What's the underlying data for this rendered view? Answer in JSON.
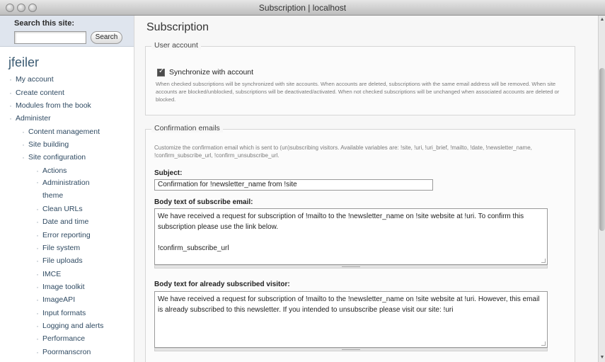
{
  "window": {
    "title": "Subscription | localhost"
  },
  "sidebar": {
    "search_label": "Search this site:",
    "search_placeholder": "",
    "search_button": "Search",
    "username": "jfeiler",
    "items": [
      "My account",
      "Create content",
      "Modules from the book",
      "Administer",
      "Content management",
      "Site building",
      "Site configuration",
      "Actions",
      "Administration theme",
      "Clean URLs",
      "Date and time",
      "Error reporting",
      "File system",
      "File uploads",
      "IMCE",
      "Image toolkit",
      "ImageAPI",
      "Input formats",
      "Logging and alerts",
      "Performance",
      "Poormanscron"
    ]
  },
  "main": {
    "page_title": "Subscription",
    "user_account": {
      "legend": "User account",
      "sync_label": "Synchronize with account",
      "sync_checked": true,
      "description": "When checked subscriptions will be synchronized with site accounts. When accounts are deleted, subscriptions with the same email address will be removed. When site accounts are blocked/unblocked, subscriptions will be deactivated/activated. When not checked subscriptions will be unchanged when associated accounts are deleted or blocked."
    },
    "confirmation": {
      "legend": "Confirmation emails",
      "description": "Customize the confirmation email which is sent to (un)subscribing visitors. Available variables are: !site, !uri, !uri_brief, !mailto, !date, !newsletter_name, !confirm_subscribe_url, !confirm_unsubscribe_url.",
      "subject_label": "Subject:",
      "subject_value": "Confirmation for !newsletter_name from !site",
      "body_subscribe_label": "Body text of subscribe email:",
      "body_subscribe_value": "We have received a request for subscription of !mailto to the !newsletter_name on !site website at !uri. To confirm this subscription please use the link below.\n\n!confirm_subscribe_url",
      "body_already_label": "Body text for already subscribed visitor:",
      "body_already_value": "We have received a request for subscription of !mailto to the !newsletter_name on !site website at !uri. However, this email is already subscribed to this newsletter. If you intended to unsubscribe please visit our site: !uri"
    }
  },
  "scrollbar": {
    "up_icon": "triangle-up",
    "down_icon": "triangle-down"
  }
}
